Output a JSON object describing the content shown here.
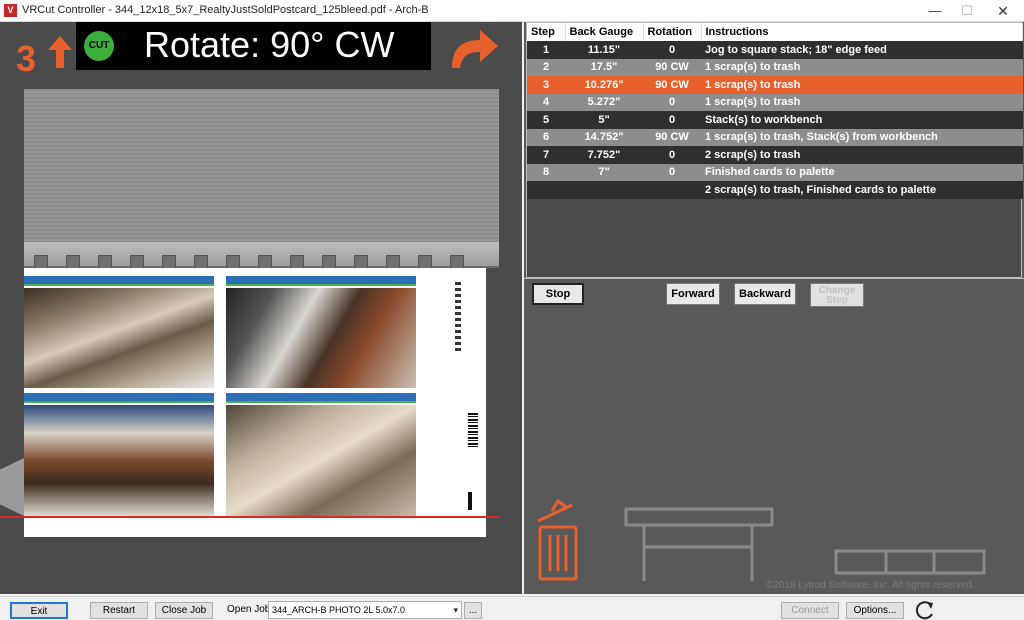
{
  "window": {
    "title": "VRCut Controller - 344_12x18_5x7_RealtyJustSoldPostcard_125bleed.pdf - Arch-B",
    "minimize": "—",
    "maximize": "☐",
    "close": "✕"
  },
  "command": {
    "step_number": "3",
    "badge": "CUT",
    "text": "Rotate: 90° CW"
  },
  "steps_table": {
    "headers": [
      "Step",
      "Back Gauge",
      "Rotation",
      "Instructions"
    ],
    "current_step": "3",
    "rows": [
      {
        "step": "1",
        "gauge": "11.15\"",
        "rotation": "0",
        "instructions": "Jog to square stack; 18\" edge feed"
      },
      {
        "step": "2",
        "gauge": "17.5\"",
        "rotation": "90 CW",
        "instructions": "1 scrap(s) to trash"
      },
      {
        "step": "3",
        "gauge": "10.276\"",
        "rotation": "90 CW",
        "instructions": "1 scrap(s) to trash"
      },
      {
        "step": "4",
        "gauge": "5.272\"",
        "rotation": "0",
        "instructions": "1 scrap(s) to trash"
      },
      {
        "step": "5",
        "gauge": "5\"",
        "rotation": "0",
        "instructions": "Stack(s) to workbench"
      },
      {
        "step": "6",
        "gauge": "14.752\"",
        "rotation": "90 CW",
        "instructions": "1 scrap(s) to trash, Stack(s) from workbench"
      },
      {
        "step": "7",
        "gauge": "7.752\"",
        "rotation": "0",
        "instructions": "2 scrap(s) to trash"
      },
      {
        "step": "8",
        "gauge": "7\"",
        "rotation": "0",
        "instructions": "Finished cards to palette"
      },
      {
        "step": "",
        "gauge": "",
        "rotation": "",
        "instructions": "2 scrap(s) to trash, Finished cards to palette"
      }
    ]
  },
  "controls": {
    "stop": "Stop",
    "forward": "Forward",
    "backward": "Backward",
    "change_step_line1": "Change",
    "change_step_line2": "Step"
  },
  "copyright": "©2018 Lytrod Software, Inc. All rights reserved.",
  "bottom_bar": {
    "exit": "Exit",
    "restart": "Restart",
    "close_job": "Close Job",
    "open_job_label": "Open Job:",
    "open_job_value": "344_ARCH-B PHOTO 2L 5.0x7.0",
    "browse": "...",
    "connect": "Connect",
    "options": "Options..."
  },
  "colors": {
    "accent": "#e8602c",
    "cut_badge": "#3cae3c",
    "cut_line": "#d42a2a"
  },
  "icons": [
    "up-arrow-icon",
    "rotate-cw-icon",
    "trash-icon",
    "workbench-icon",
    "palette-icon",
    "refresh-icon",
    "chevron-down-icon"
  ]
}
